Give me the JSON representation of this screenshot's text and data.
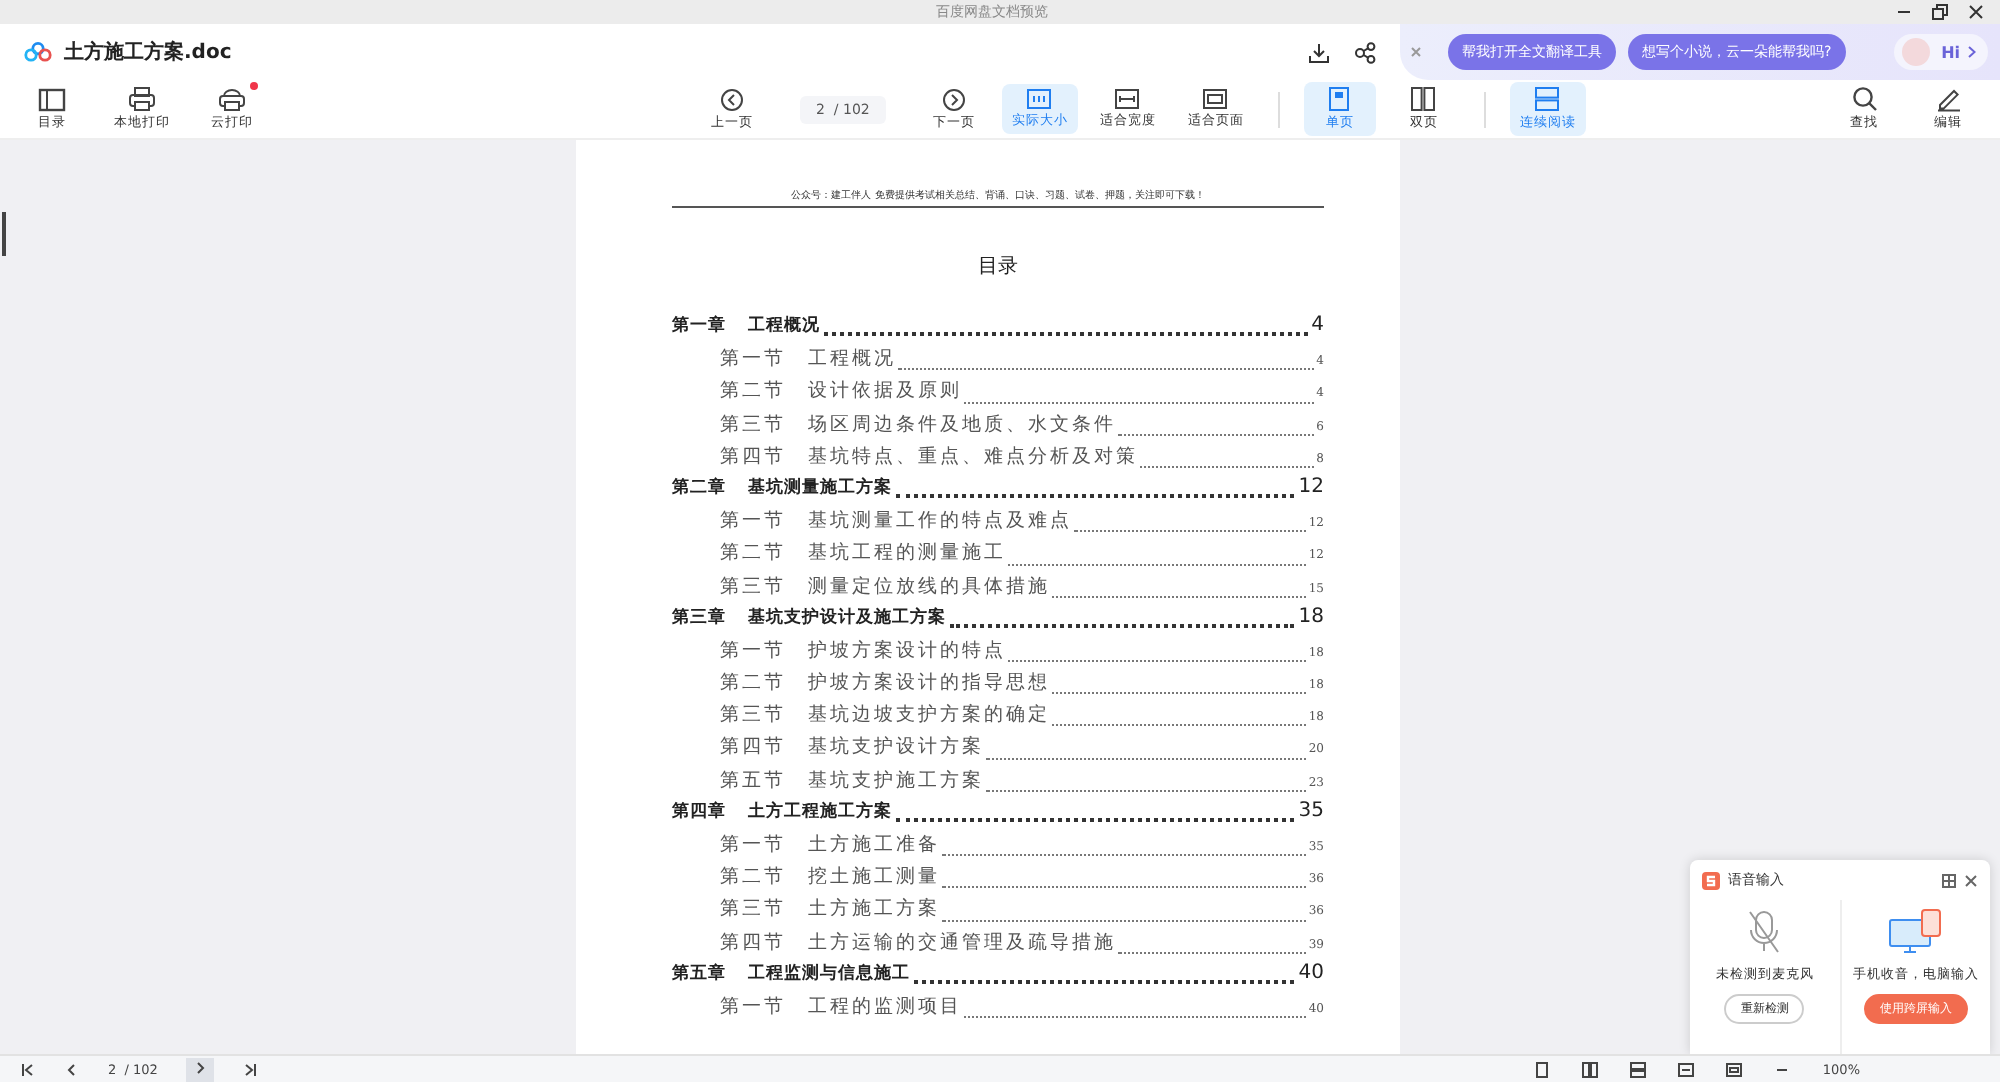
{
  "window": {
    "title": "百度网盘文档预览"
  },
  "header": {
    "filename": "土方施工方案.doc"
  },
  "assistant": {
    "suggestions": [
      "帮我打开全文翻译工具",
      "想写个小说，云一朵能帮我吗?"
    ],
    "greeting": "Hi"
  },
  "toolbar": {
    "left": [
      {
        "label": "目录",
        "kind": "toc",
        "badge": false
      },
      {
        "label": "本地打印",
        "kind": "print",
        "badge": false
      },
      {
        "label": "云打印",
        "kind": "cloudprint",
        "badge": true
      }
    ],
    "center": [
      {
        "label": "上一页",
        "kind": "prev",
        "selected": false
      },
      {
        "kind": "pager",
        "page": "2",
        "total": "/ 102"
      },
      {
        "label": "下一页",
        "kind": "next",
        "selected": false
      },
      {
        "label": "实际大小",
        "kind": "actual",
        "selected": true
      },
      {
        "label": "适合宽度",
        "kind": "fitwidth",
        "selected": false
      },
      {
        "label": "适合页面",
        "kind": "fitpage",
        "selected": false
      },
      {
        "kind": "sep"
      },
      {
        "label": "单页",
        "kind": "single",
        "selected": true
      },
      {
        "label": "双页",
        "kind": "double",
        "selected": false
      },
      {
        "kind": "sep"
      },
      {
        "label": "连续阅读",
        "kind": "continuous",
        "selected": true
      }
    ],
    "right": [
      {
        "label": "查找",
        "kind": "search"
      },
      {
        "label": "编辑",
        "kind": "edit"
      }
    ]
  },
  "document": {
    "header_note": "公众号：建工伴人 免费提供考试相关总结、背诵、口诀、习题、试卷、押题，关注即可下载！",
    "heading": "目录",
    "toc": [
      {
        "label": "第一章",
        "title": "工程概况",
        "page": "4",
        "children": [
          {
            "label": "第一节",
            "title": "工程概况",
            "page": "4"
          },
          {
            "label": "第二节",
            "title": "设计依据及原则",
            "page": "4"
          },
          {
            "label": "第三节",
            "title": "场区周边条件及地质、水文条件",
            "page": "6"
          },
          {
            "label": "第四节",
            "title": "基坑特点、重点、难点分析及对策",
            "page": "8"
          }
        ]
      },
      {
        "label": "第二章",
        "title": "基坑测量施工方案",
        "page": "12",
        "children": [
          {
            "label": "第一节",
            "title": "基坑测量工作的特点及难点",
            "page": "12"
          },
          {
            "label": "第二节",
            "title": "基坑工程的测量施工",
            "page": "12"
          },
          {
            "label": "第三节",
            "title": "测量定位放线的具体措施",
            "page": "15"
          }
        ]
      },
      {
        "label": "第三章",
        "title": "基坑支护设计及施工方案",
        "page": "18",
        "children": [
          {
            "label": "第一节",
            "title": "护坡方案设计的特点",
            "page": "18"
          },
          {
            "label": "第二节",
            "title": "护坡方案设计的指导思想",
            "page": "18"
          },
          {
            "label": "第三节",
            "title": "基坑边坡支护方案的确定",
            "page": "18"
          },
          {
            "label": "第四节",
            "title": "基坑支护设计方案",
            "page": "20"
          },
          {
            "label": "第五节",
            "title": "基坑支护施工方案",
            "page": "23"
          }
        ]
      },
      {
        "label": "第四章",
        "title": "土方工程施工方案",
        "page": "35",
        "children": [
          {
            "label": "第一节",
            "title": "土方施工准备",
            "page": "35"
          },
          {
            "label": "第二节",
            "title": "挖土施工测量",
            "page": "36"
          },
          {
            "label": "第三节",
            "title": "土方施工方案",
            "page": "36"
          },
          {
            "label": "第四节",
            "title": "土方运输的交通管理及疏导措施",
            "page": "39"
          }
        ]
      },
      {
        "label": "第五章",
        "title": "工程监测与信息施工",
        "page": "40",
        "children": [
          {
            "label": "第一节",
            "title": "工程的监测项目",
            "page": "40"
          }
        ]
      }
    ]
  },
  "voice_panel": {
    "title": "语音输入",
    "left_caption": "未检测到麦克风",
    "left_button": "重新检测",
    "right_caption": "手机收音，电脑输入",
    "right_button": "使用跨屏输入"
  },
  "status_bar": {
    "page": "2",
    "total": "/ 102",
    "zoom": "100%"
  }
}
